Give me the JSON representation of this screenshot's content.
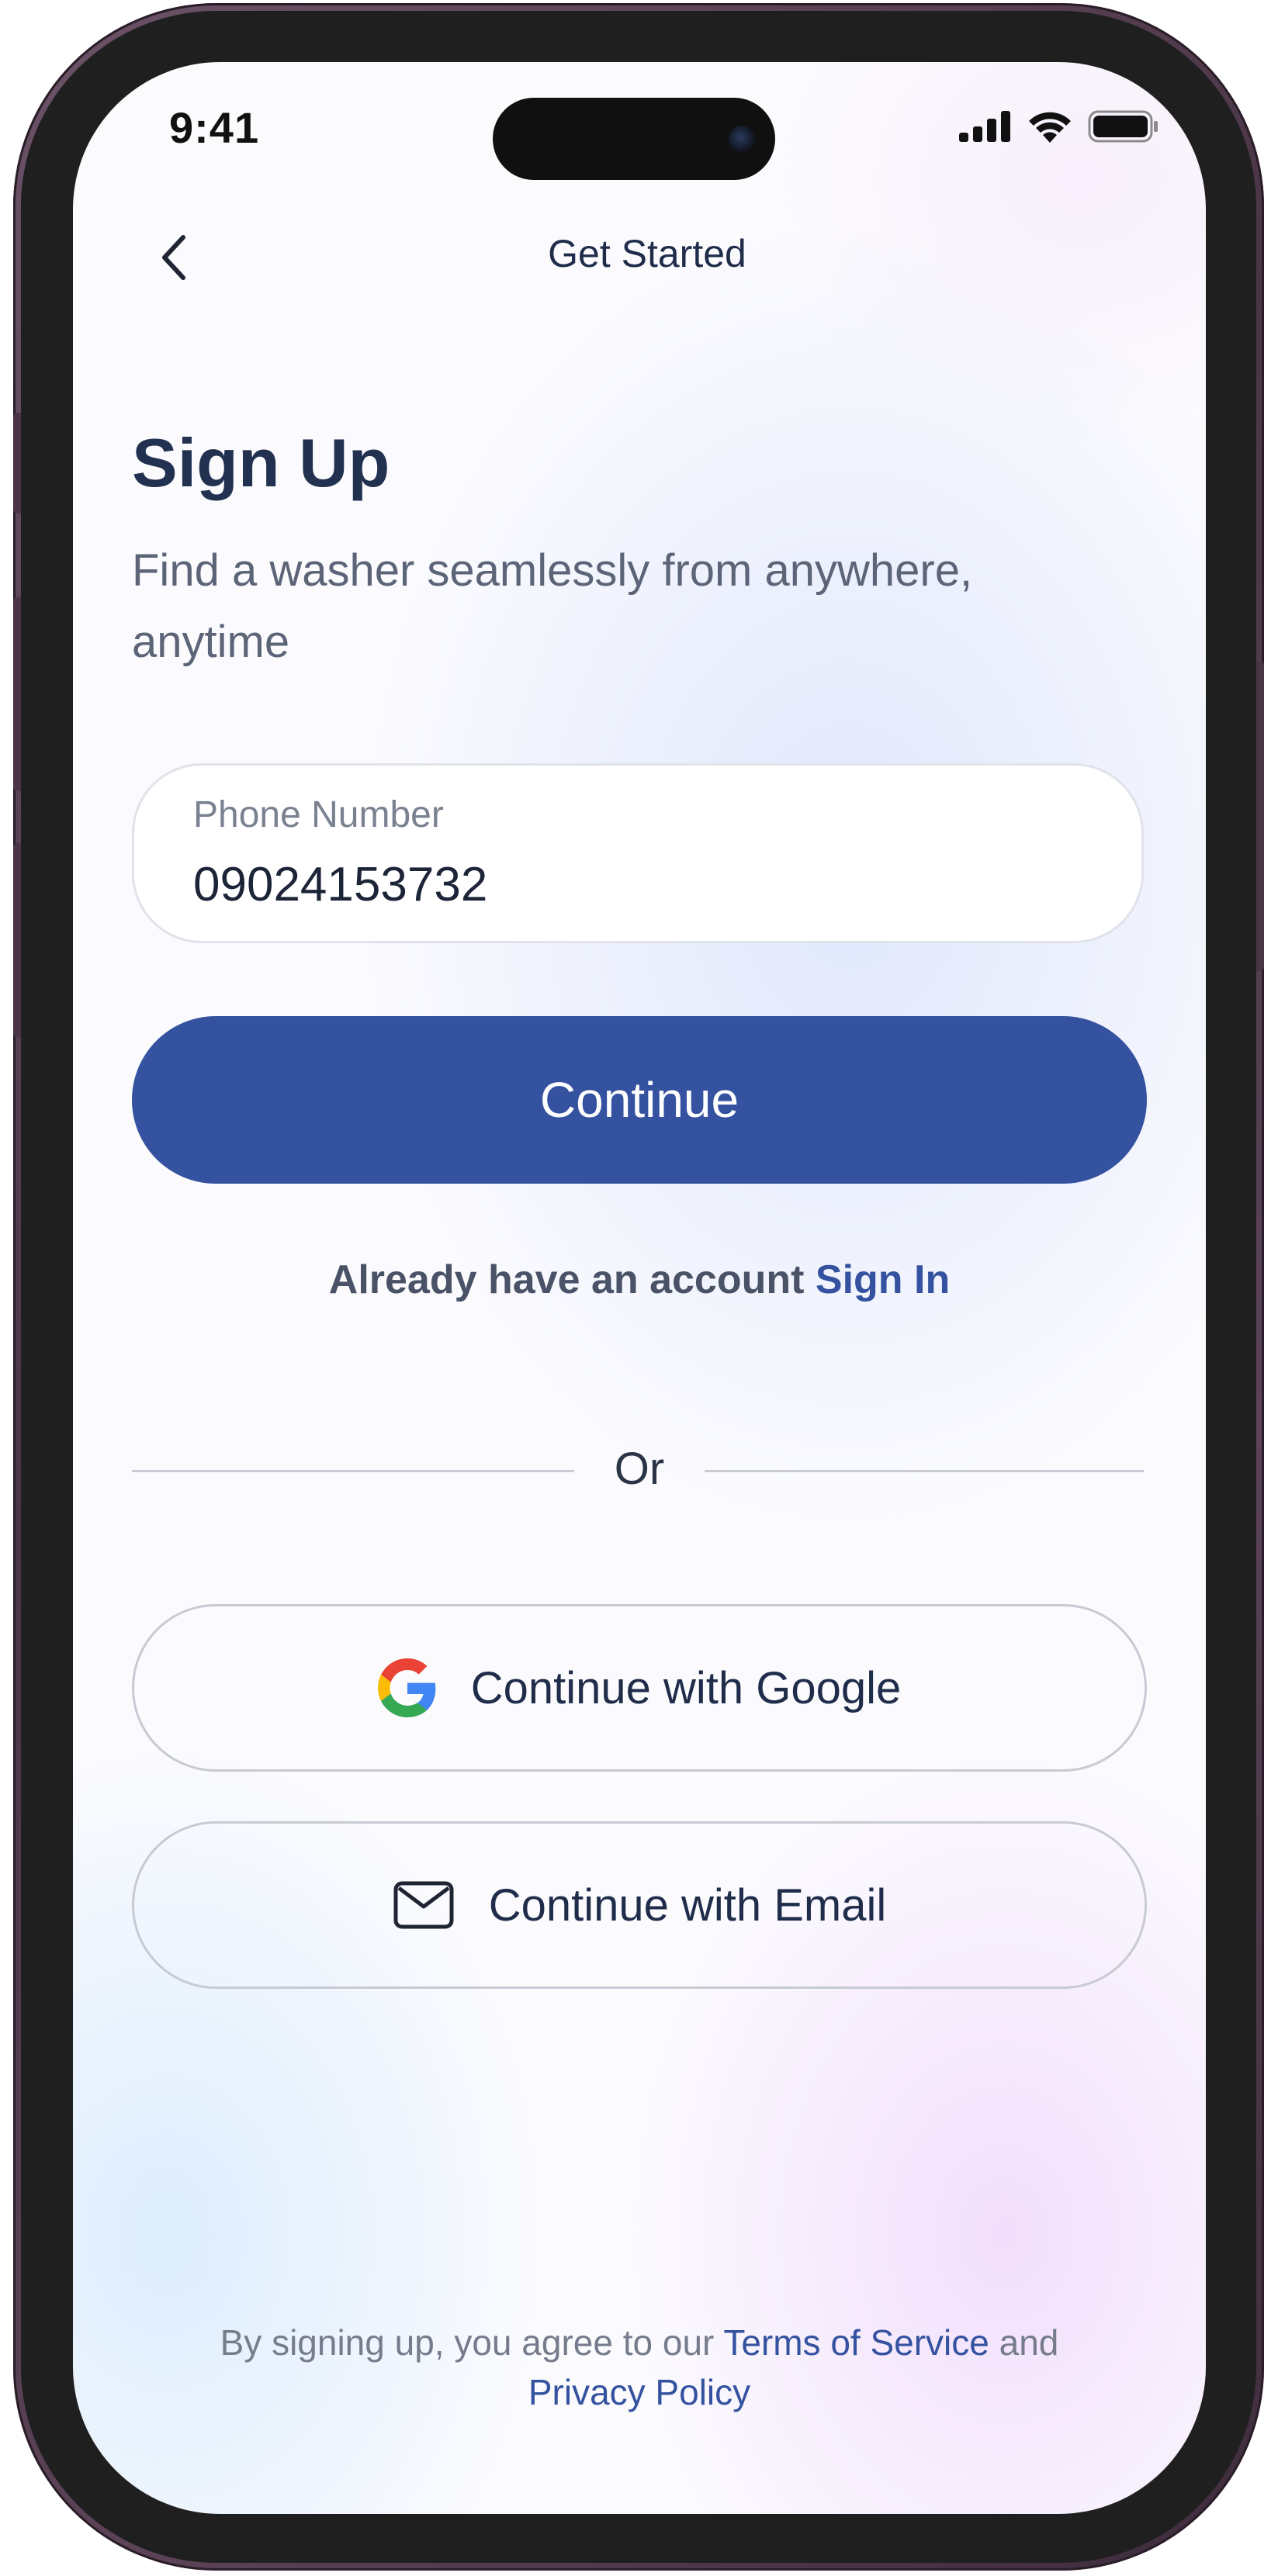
{
  "status_bar": {
    "time": "9:41"
  },
  "header": {
    "title": "Get Started",
    "back_icon": "chevron-left-icon"
  },
  "main": {
    "title": "Sign Up",
    "subtitle": "Find a washer seamlessly from anywhere, anytime",
    "phone_field": {
      "label": "Phone Number",
      "value": "09024153732"
    },
    "continue_label": "Continue",
    "signin_prompt": "Already have an account ",
    "signin_link": "Sign In",
    "divider_text": "Or",
    "google_label": "Continue with Google",
    "email_label": "Continue with Email"
  },
  "footer": {
    "prefix": "By signing up, you agree to our ",
    "terms": "Terms of Service",
    "and": " and",
    "privacy": "Privacy Policy"
  },
  "colors": {
    "primary": "#34529f",
    "title": "#22314f",
    "device_frame": "#4a3546"
  }
}
